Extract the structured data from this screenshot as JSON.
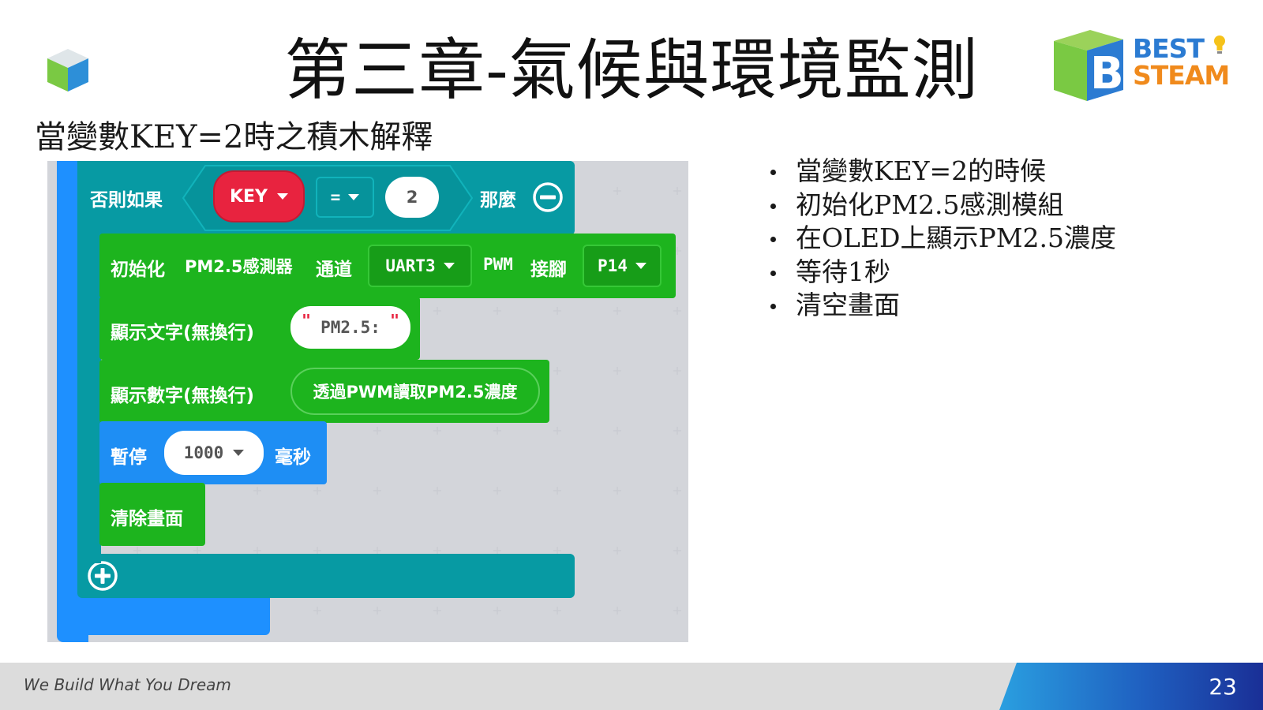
{
  "slide": {
    "title": "第三章-氣候與環境監測",
    "subtitle": "當變數KEY=2時之積木解釋",
    "page_number": "23"
  },
  "brand": {
    "line1": "BEST",
    "line2": "STEAM",
    "blue": "#2b7bd2",
    "orange": "#f08a1c"
  },
  "blocks": {
    "elseif": {
      "label": "否則如果",
      "variable": "KEY",
      "operator": "=",
      "value": "2",
      "then": "那麼"
    },
    "init_pm25": {
      "label_init": "初始化",
      "label_sensor": "PM2.5感測器",
      "label_channel": "通道",
      "channel": "UART3",
      "label_pwm": "PWM",
      "label_pin": "接腳",
      "pin": "P14"
    },
    "show_text": {
      "label": "顯示文字(無換行)",
      "value": "PM2.5:"
    },
    "show_number": {
      "label": "顯示數字(無換行)",
      "value": "透過PWM讀取PM2.5濃度"
    },
    "pause": {
      "label": "暫停",
      "value": "1000",
      "unit": "毫秒"
    },
    "clear": {
      "label": "清除畫面"
    },
    "colors": {
      "teal": "#079aa3",
      "green": "#1db41e",
      "blue": "#1e8ef4",
      "red": "#e8233f"
    }
  },
  "bullets": [
    "當變數KEY=2的時候",
    "初始化PM2.5感測模組",
    "在OLED上顯示PM2.5濃度",
    "等待1秒",
    "清空畫面"
  ],
  "footer": {
    "tagline": "We Build What You Dream"
  }
}
